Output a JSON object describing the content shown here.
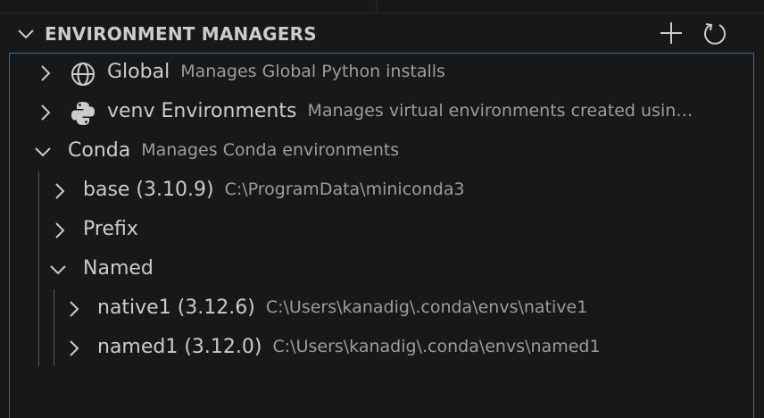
{
  "header": {
    "title": "ENVIRONMENT MANAGERS",
    "add_icon": "plus-icon",
    "refresh_icon": "refresh-icon"
  },
  "tree": {
    "items": [
      {
        "label": "Global",
        "description": "Manages Global Python installs",
        "icon": "globe-icon",
        "expanded": false
      },
      {
        "label": "venv Environments",
        "description": "Manages virtual environments created usin…",
        "icon": "python-icon",
        "expanded": false
      },
      {
        "label": "Conda",
        "description": "Manages Conda environments",
        "expanded": true,
        "children": [
          {
            "label": "base (3.10.9)",
            "description": "C:\\ProgramData\\miniconda3",
            "expanded": false
          },
          {
            "label": "Prefix",
            "description": "",
            "expanded": false
          },
          {
            "label": "Named",
            "description": "",
            "expanded": true,
            "children": [
              {
                "label": "native1 (3.12.6)",
                "description": "C:\\Users\\kanadig\\.conda\\envs\\native1",
                "expanded": false
              },
              {
                "label": "named1 (3.12.0)",
                "description": "C:\\Users\\kanadig\\.conda\\envs\\named1",
                "expanded": false
              }
            ]
          }
        ]
      }
    ]
  },
  "colors": {
    "background": "#181818",
    "focus_border": "#0078d4",
    "label": "#cccccc",
    "description": "#9d9d9d"
  }
}
